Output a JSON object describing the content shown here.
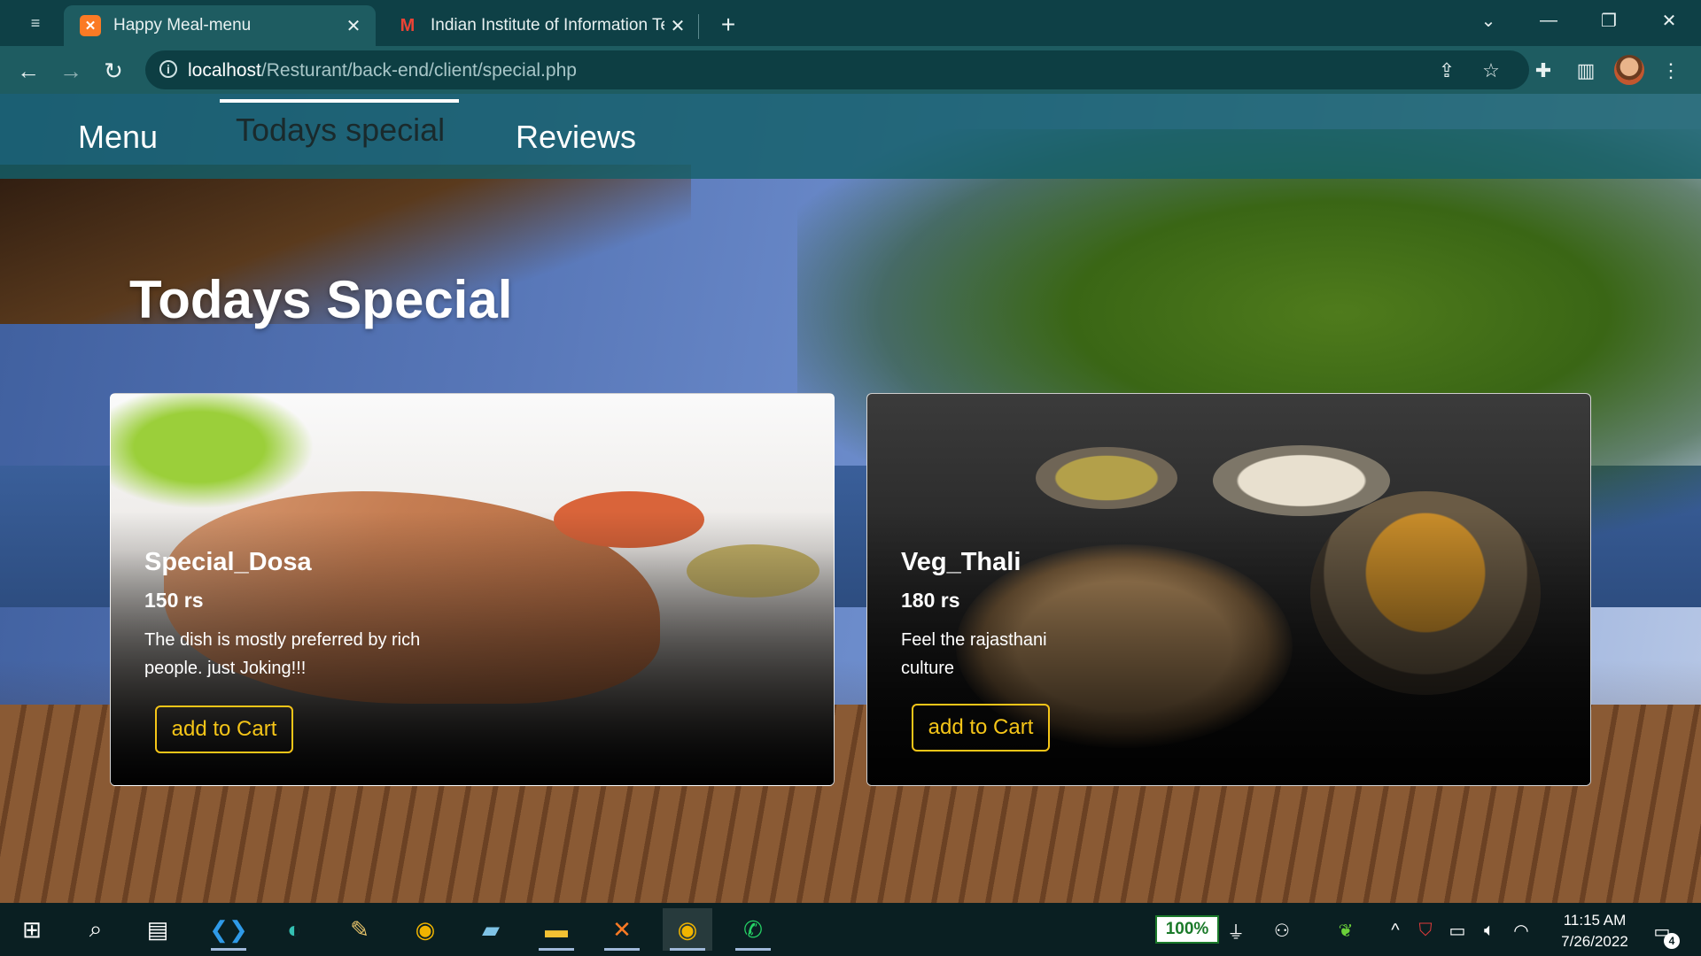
{
  "browser": {
    "tabs": [
      {
        "title": "Happy Meal-menu",
        "favicon": "xampp-icon",
        "active": true
      },
      {
        "title": "Indian Institute of Information Te",
        "favicon": "gmail-icon",
        "active": false
      }
    ],
    "new_tab_label": "+",
    "address": {
      "host": "localhost",
      "path": "/Resturant/back-end/client/special.php"
    }
  },
  "site_nav": {
    "items": [
      {
        "label": "Menu"
      },
      {
        "label": "Todays special",
        "active": true
      },
      {
        "label": "Reviews"
      }
    ]
  },
  "page": {
    "title": "Todays Special"
  },
  "cards": [
    {
      "name": "Special_Dosa",
      "price": "150 rs",
      "description": "The dish is mostly preferred by rich people. just Joking!!!",
      "button": "add to Cart"
    },
    {
      "name": "Veg_Thali",
      "price": "180 rs",
      "description": "Feel the rajasthani culture",
      "button": "add to Cart"
    }
  ],
  "taskbar": {
    "battery": "100%",
    "time": "11:15 AM",
    "date": "7/26/2022",
    "notifications": "4"
  },
  "colors": {
    "accent_button": "#f5c518",
    "nav_bar": "#145f69",
    "browser_frame": "#0e4046"
  }
}
